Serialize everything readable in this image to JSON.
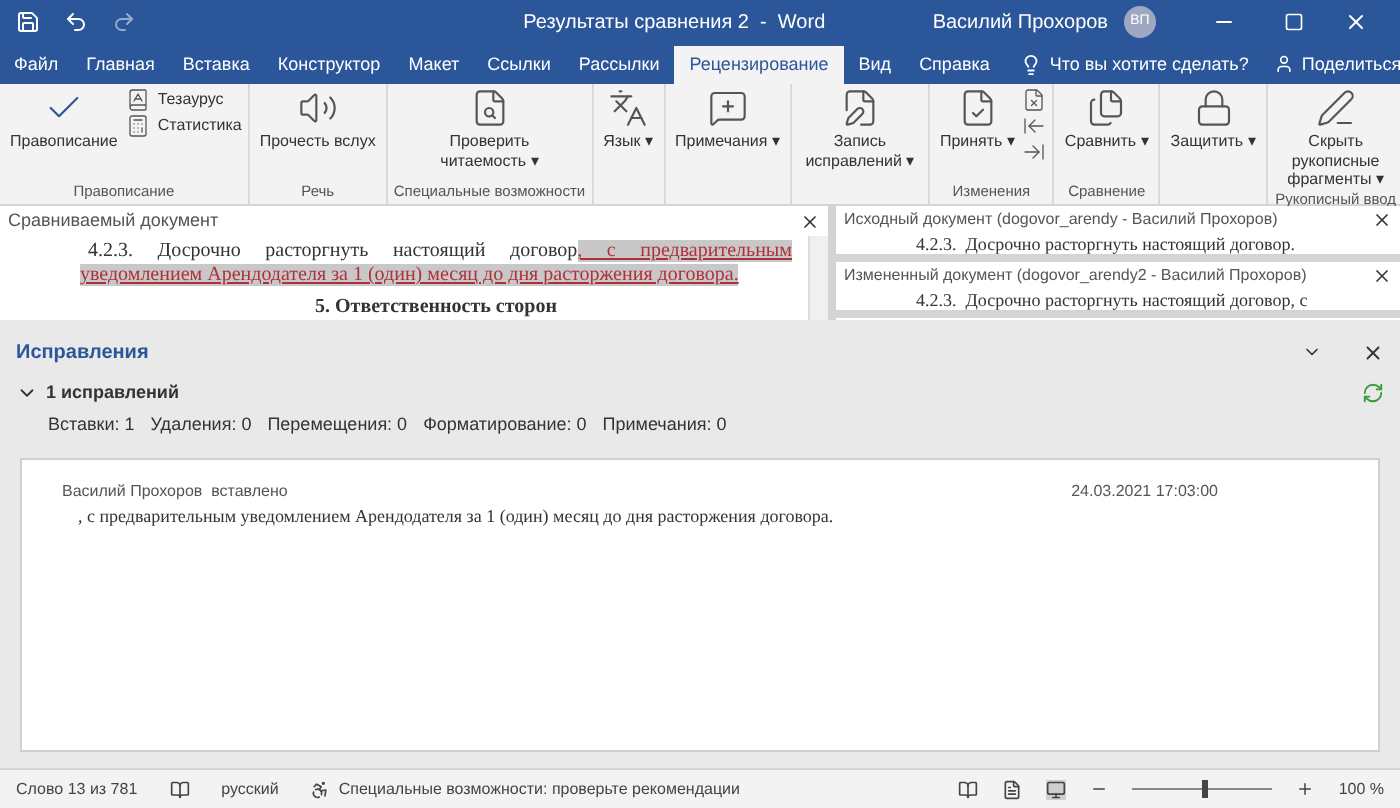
{
  "window": {
    "title": "Результаты сравнения 2  -  Word",
    "user": "Василий Прохоров",
    "avatar": "ВП"
  },
  "tabs": [
    {
      "label": "Файл",
      "selected": false
    },
    {
      "label": "Главная",
      "selected": false
    },
    {
      "label": "Вставка",
      "selected": false
    },
    {
      "label": "Конструктор",
      "selected": false
    },
    {
      "label": "Макет",
      "selected": false
    },
    {
      "label": "Ссылки",
      "selected": false
    },
    {
      "label": "Рассылки",
      "selected": false
    },
    {
      "label": "Рецензирование",
      "selected": true
    },
    {
      "label": "Вид",
      "selected": false
    },
    {
      "label": "Справка",
      "selected": false
    }
  ],
  "tell_me": {
    "placeholder": "Что вы хотите сделать?"
  },
  "share": "Поделиться",
  "ribbon": [
    {
      "label": "Правописание",
      "buttons": [
        {
          "kind": "large",
          "label": "Правописание"
        },
        {
          "kind": "stack",
          "items": [
            {
              "kind": "labeled",
              "label": "Тезаурус"
            },
            {
              "kind": "labeled",
              "label": "Статистика"
            }
          ]
        }
      ]
    },
    {
      "label": "Речь",
      "buttons": [
        {
          "kind": "large",
          "label": "Прочесть вслух"
        }
      ]
    },
    {
      "label": "Специальные возможности",
      "buttons": [
        {
          "kind": "large",
          "label": "Проверить читаемость ▾"
        }
      ]
    },
    {
      "buttons": [
        {
          "kind": "large",
          "label": "Язык ▾"
        }
      ]
    },
    {
      "buttons": [
        {
          "kind": "large",
          "label": "Примечания ▾"
        }
      ]
    },
    {
      "buttons": [
        {
          "kind": "large",
          "label": "Запись исправлений ▾"
        }
      ]
    },
    {
      "label": "Изменения",
      "buttons": [
        {
          "kind": "large",
          "label": "Принять ▾"
        },
        {
          "kind": "stack",
          "items": [
            {
              "kind": "icon"
            },
            {
              "kind": "icon"
            },
            {
              "kind": "icon"
            }
          ]
        }
      ]
    },
    {
      "label": "Сравнение",
      "buttons": [
        {
          "kind": "large",
          "label": "Сравнить ▾"
        }
      ]
    },
    {
      "buttons": [
        {
          "kind": "large",
          "label": "Защитить ▾"
        }
      ]
    },
    {
      "label": "Рукописный ввод",
      "buttons": [
        {
          "kind": "large",
          "label": "Скрыть рукописные фрагменты ▾"
        }
      ]
    }
  ],
  "compared": {
    "title": "Сравниваемый документ",
    "paragraph_start": "4.2.3. Досрочно расторгнуть настоящий договор",
    "paragraph_inserted": ", с предварительным уведомлением Арендодателя за 1 (один) месяц до дня расторжения договора.",
    "heading": "5. Ответственность сторон"
  },
  "original": {
    "title": "Исходный документ (dogovor_arendy - Василий Прохоров)",
    "text": "4.2.3.  Досрочно расторгнуть настоящий договор."
  },
  "revised": {
    "title": "Измененный документ (dogovor_arendy2 - Василий Прохоров)",
    "text": "4.2.3.  Досрочно расторгнуть настоящий договор, с"
  },
  "revisions": {
    "title": "Исправления",
    "summary": "1 исправлений",
    "expanded": true,
    "counts": [
      "Вставки: 1",
      "Удаления: 0",
      "Перемещения: 0",
      "Форматирование: 0",
      "Примечания: 0"
    ],
    "items": [
      {
        "author": "Василий Прохоров",
        "action": "вставлено",
        "date": "24.03.2021 17:03:00",
        "text": ", с предварительным уведомлением Арендодателя за 1 (один) месяц до дня расторжения договора."
      }
    ]
  },
  "status_bar": {
    "page": "Слово 13 из 781",
    "language": "русский",
    "accessibility": "Специальные возможности: проверьте рекомендации",
    "zoom": "100 %",
    "zoom_slider": {
      "level": 0.5
    }
  }
}
